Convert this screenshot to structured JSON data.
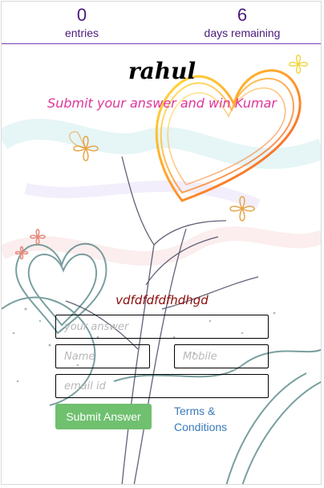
{
  "stats": {
    "entries_count": "0",
    "entries_label": "entries",
    "days_count": "6",
    "days_label": "days remaining"
  },
  "contest": {
    "title": "rahul",
    "subtitle": "Submit your answer and win Kumar",
    "question": "vdfdfdfdfhdhgd"
  },
  "form": {
    "answer_placeholder": "your answer",
    "name_placeholder": "Name",
    "mobile_placeholder": "Mobile",
    "email_placeholder": "email id",
    "submit_label": "Submit Answer",
    "terms_label": "Terms & Conditions"
  },
  "colors": {
    "accent_purple": "#4a1a7a",
    "subtitle_pink": "#e0349a",
    "question_red": "#8b0a0a",
    "submit_green": "#6fc06f",
    "link_blue": "#3b7ab8"
  }
}
